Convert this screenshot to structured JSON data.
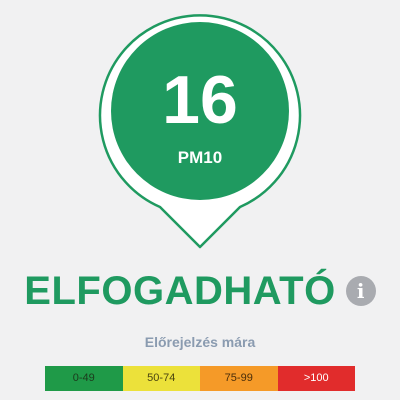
{
  "reading": {
    "value": "16",
    "pollutant": "PM10",
    "color": "#1f9a60"
  },
  "status": {
    "label": "ELFOGADHATÓ",
    "info_icon": "info-icon",
    "info_glyph": "i"
  },
  "forecast": {
    "label": "Előrejelzés mára"
  },
  "legend": {
    "segments": [
      {
        "label": "0-49",
        "color": "#1f9a48",
        "text_color": "#1c3a1c"
      },
      {
        "label": "50-74",
        "color": "#ece13a",
        "text_color": "#4a4410"
      },
      {
        "label": "75-99",
        "color": "#f59a28",
        "text_color": "#4a2e0a"
      },
      {
        "label": ">100",
        "color": "#e12c2c",
        "text_color": "#ffffff"
      }
    ]
  }
}
